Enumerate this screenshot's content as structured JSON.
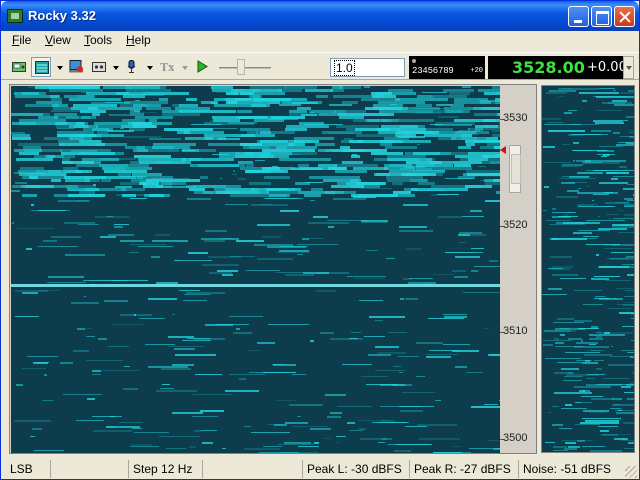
{
  "window": {
    "title": "Rocky 3.32"
  },
  "menu": {
    "items": [
      {
        "label": "File",
        "key": "F",
        "rest": "ile"
      },
      {
        "label": "View",
        "key": "V",
        "rest": "iew"
      },
      {
        "label": "Tools",
        "key": "T",
        "rest": "ools"
      },
      {
        "label": "Help",
        "key": "H",
        "rest": "elp"
      }
    ]
  },
  "toolbar": {
    "tools": [
      {
        "name": "radio-settings-icon",
        "pressed": false
      },
      {
        "name": "waterfall-view-icon",
        "pressed": true
      },
      {
        "name": "record-icon",
        "pressed": false
      },
      {
        "name": "cassette-icon",
        "pressed": false
      },
      {
        "name": "microphone-icon",
        "pressed": false
      },
      {
        "name": "transmit-icon",
        "pressed": false
      },
      {
        "name": "play-icon",
        "pressed": false
      }
    ],
    "speed_value": "1.0",
    "digits_display": "23456789",
    "digits_offset": "+20",
    "frequency": "3528.00",
    "rit_offset": "+0.00"
  },
  "scale": {
    "labels": [
      "3530",
      "3520",
      "3510",
      "3500"
    ]
  },
  "colors": {
    "waterfall_bg": "#0d3d4c",
    "signal": "#22d6e0",
    "freq_text": "#3be43b"
  },
  "status": {
    "mode": "LSB",
    "empty1": "",
    "step": "Step 12 Hz",
    "empty2": "",
    "peak_l": "Peak L: -30 dBFS",
    "peak_r": "Peak R: -27 dBFS",
    "noise": "Noise: -51 dBFS"
  }
}
